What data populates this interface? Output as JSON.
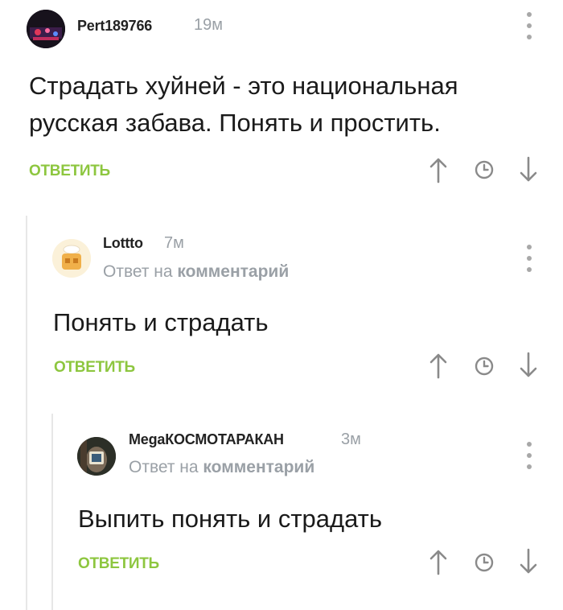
{
  "colors": {
    "accent": "#8dc63f",
    "muted": "#9aa0a6"
  },
  "comments": [
    {
      "author": "Pert189766",
      "time": "19м",
      "reply_prefix": "",
      "reply_target": "",
      "text_lines": [
        "Страдать хуйней - это национальная",
        "русская забава. Понять и простить."
      ],
      "reply_label": "ОТВЕТИТЬ",
      "avatar_icon": "user-photo-avatar"
    },
    {
      "author": "Lottto",
      "time": "7м",
      "reply_prefix": "Ответ на",
      "reply_target": "комментарий",
      "text_lines": [
        "Понять и страдать"
      ],
      "reply_label": "ОТВЕТИТЬ",
      "avatar_icon": "cartoon-avatar"
    },
    {
      "author": "MegaКОСМОТАРАКАН",
      "time": "3м",
      "reply_prefix": "Ответ на",
      "reply_target": "комментарий",
      "text_lines": [
        "Выпить понять и страдать"
      ],
      "reply_label": "ОТВЕТИТЬ",
      "avatar_icon": "user-photo-avatar"
    }
  ],
  "action_icons": [
    "arrow-up-icon",
    "clock-icon",
    "arrow-down-icon"
  ]
}
